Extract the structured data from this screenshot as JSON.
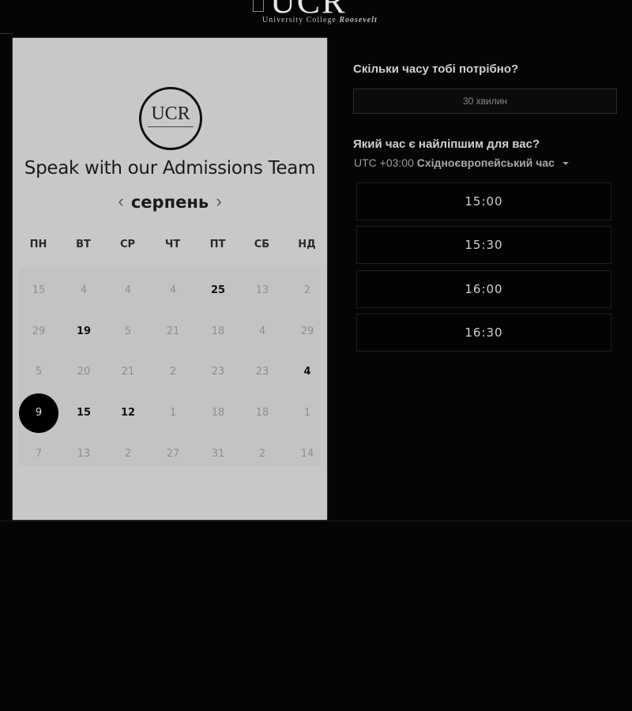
{
  "header": {
    "logo_mark": "UCR",
    "logo_sub_plain": "University College",
    "logo_sub_italic": "Roosevelt"
  },
  "card": {
    "logo_mark": "UCR",
    "title": "Speak with our Admissions Team",
    "month": "серпень",
    "prev_icon": "‹",
    "next_icon": "›",
    "weekdays": [
      "ПН",
      "ВТ",
      "СР",
      "ЧТ",
      "ПТ",
      "СБ",
      "НД"
    ],
    "weeks": [
      [
        {
          "d": "15",
          "a": false
        },
        {
          "d": "4",
          "a": false
        },
        {
          "d": "4",
          "a": false
        },
        {
          "d": "4",
          "a": false
        },
        {
          "d": "25",
          "a": true
        },
        {
          "d": "13",
          "a": false
        },
        {
          "d": "2",
          "a": false
        }
      ],
      [
        {
          "d": "29",
          "a": false
        },
        {
          "d": "19",
          "a": true
        },
        {
          "d": "5",
          "a": false
        },
        {
          "d": "21",
          "a": false
        },
        {
          "d": "18",
          "a": false
        },
        {
          "d": "4",
          "a": false
        },
        {
          "d": "29",
          "a": false
        }
      ],
      [
        {
          "d": "5",
          "a": false
        },
        {
          "d": "20",
          "a": false
        },
        {
          "d": "21",
          "a": false
        },
        {
          "d": "2",
          "a": false
        },
        {
          "d": "23",
          "a": false
        },
        {
          "d": "23",
          "a": false
        },
        {
          "d": "4",
          "a": true
        }
      ],
      [
        {
          "d": "9",
          "a": true,
          "sel": true
        },
        {
          "d": "15",
          "a": true
        },
        {
          "d": "12",
          "a": true
        },
        {
          "d": "1",
          "a": false
        },
        {
          "d": "18",
          "a": false
        },
        {
          "d": "18",
          "a": false
        },
        {
          "d": "1",
          "a": false
        }
      ],
      [
        {
          "d": "7",
          "a": false
        },
        {
          "d": "13",
          "a": false
        },
        {
          "d": "2",
          "a": false
        },
        {
          "d": "27",
          "a": false
        },
        {
          "d": "31",
          "a": false
        },
        {
          "d": "2",
          "a": false
        },
        {
          "d": "14",
          "a": false
        }
      ]
    ]
  },
  "right": {
    "duration_question": "Скільки часу тобі потрібно?",
    "duration_value": "30 хвилин",
    "time_question": "Який час є найліпшим для вас?",
    "timezone_offset": "UTC +03:00",
    "timezone_name": "Східноєвропейський час",
    "slots": [
      "15:00",
      "15:30",
      "16:00",
      "16:30"
    ]
  }
}
